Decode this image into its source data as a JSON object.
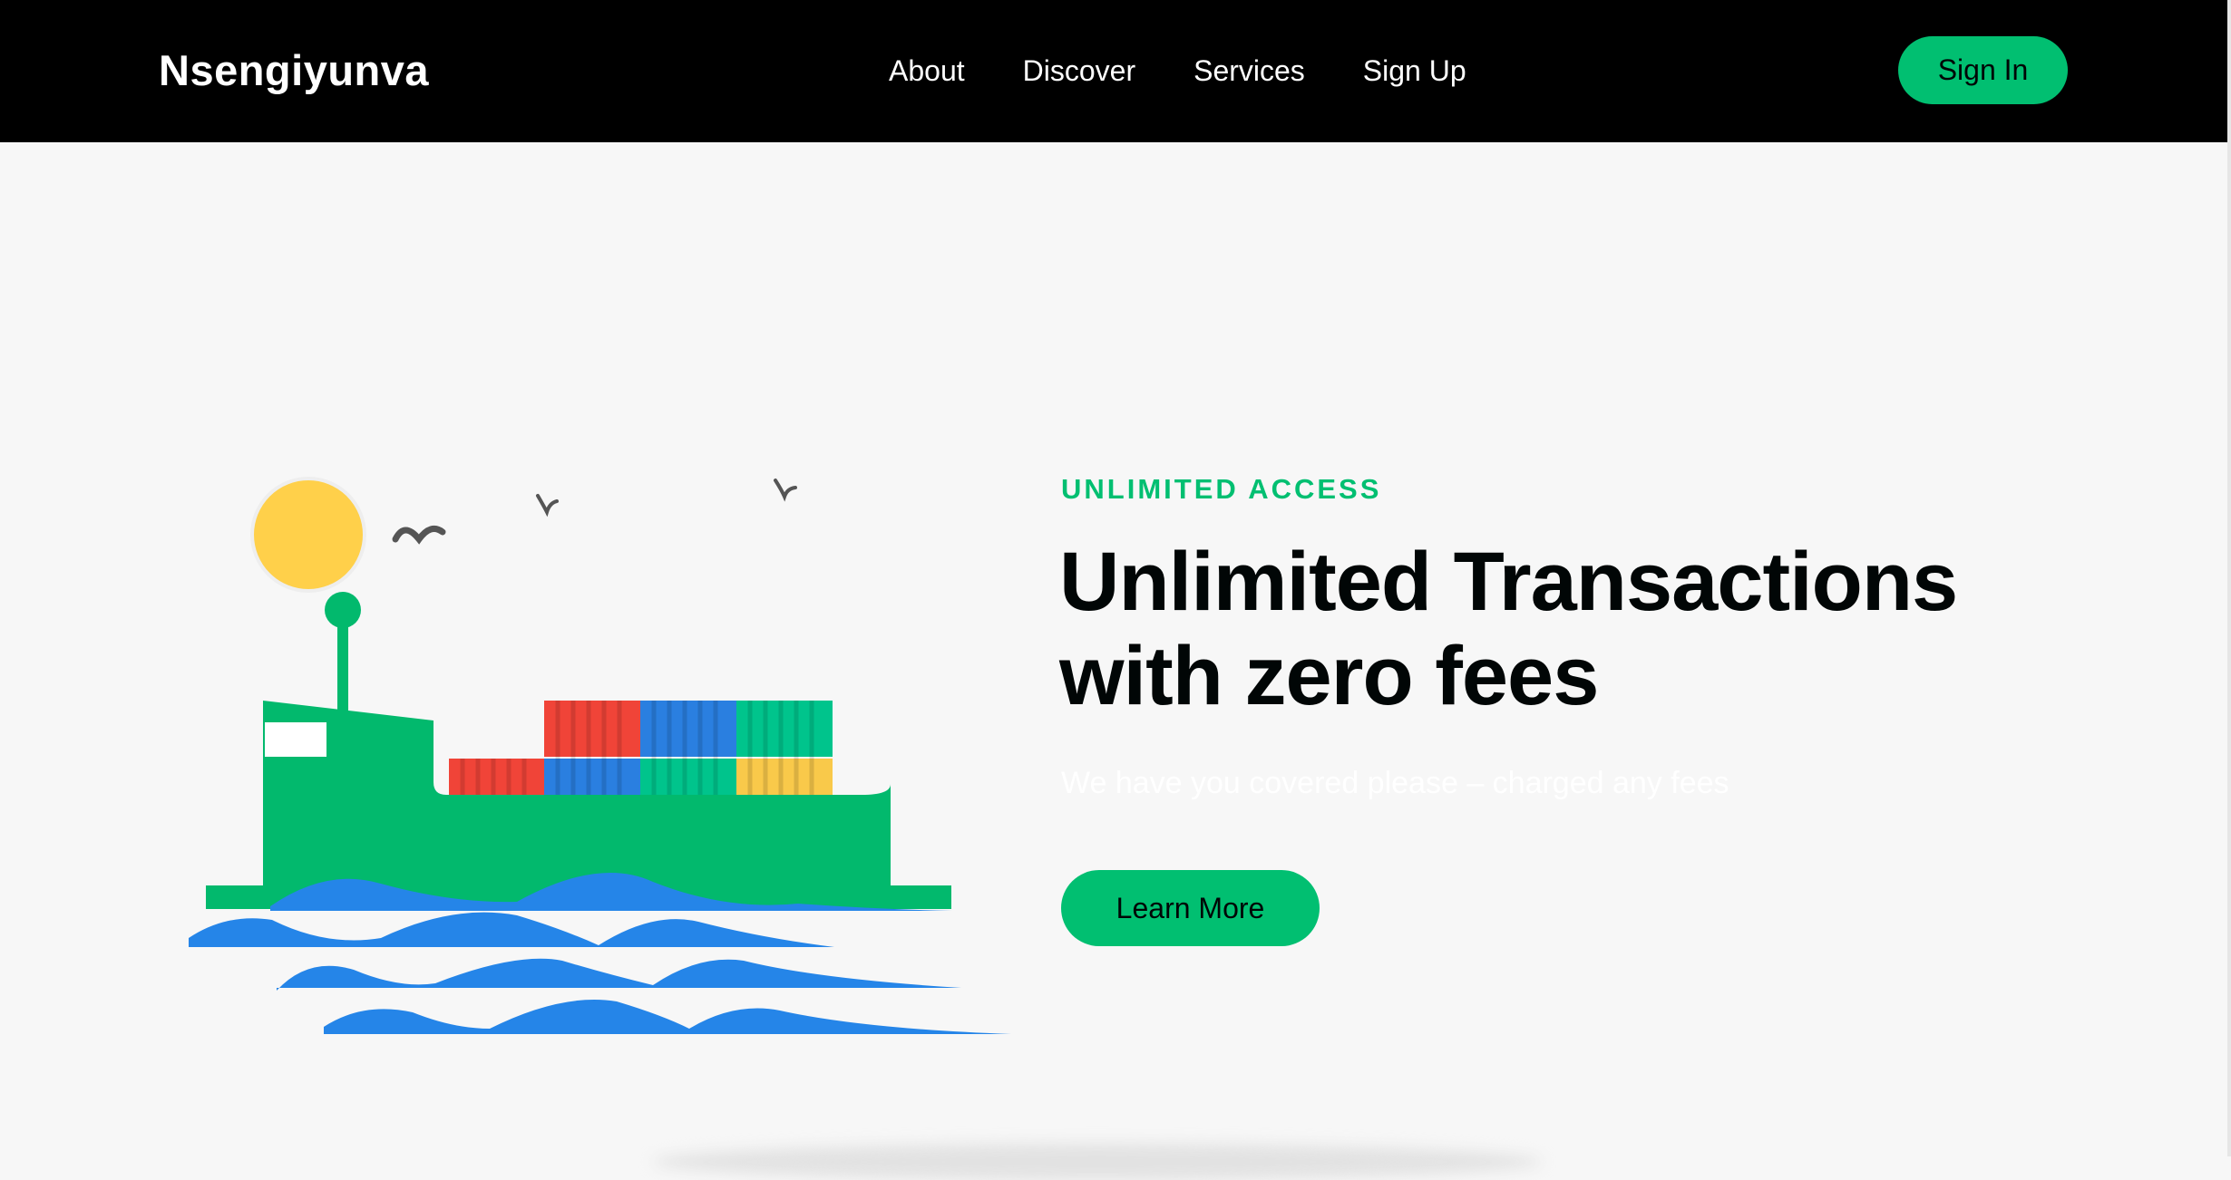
{
  "nav": {
    "brand": "Nsengiyunva",
    "links": [
      "About",
      "Discover",
      "Services",
      "Sign Up"
    ],
    "signin_label": "Sign In"
  },
  "hero": {
    "eyebrow": "UNLIMITED ACCESS",
    "headline_line1": "Unlimited Transactions",
    "headline_line2": "with zero fees",
    "subtext": "We have you covered please – charged any fees",
    "cta_label": "Learn More"
  },
  "colors": {
    "nav_bg": "#000000",
    "accent": "#01bf71",
    "page_bg": "#f7f7f7",
    "heading": "#010606",
    "ship_green": "#02b96d",
    "sun": "#ffd04a",
    "water": "#2585e8",
    "container_red": "#f04438",
    "container_blue": "#2a7fe0",
    "container_teal": "#00c48c",
    "container_yellow": "#f9c94a"
  },
  "illustration": {
    "icons": [
      "sun-icon",
      "bird-icon",
      "cargo-ship-icon",
      "shipping-container-icon",
      "waves-icon"
    ]
  }
}
